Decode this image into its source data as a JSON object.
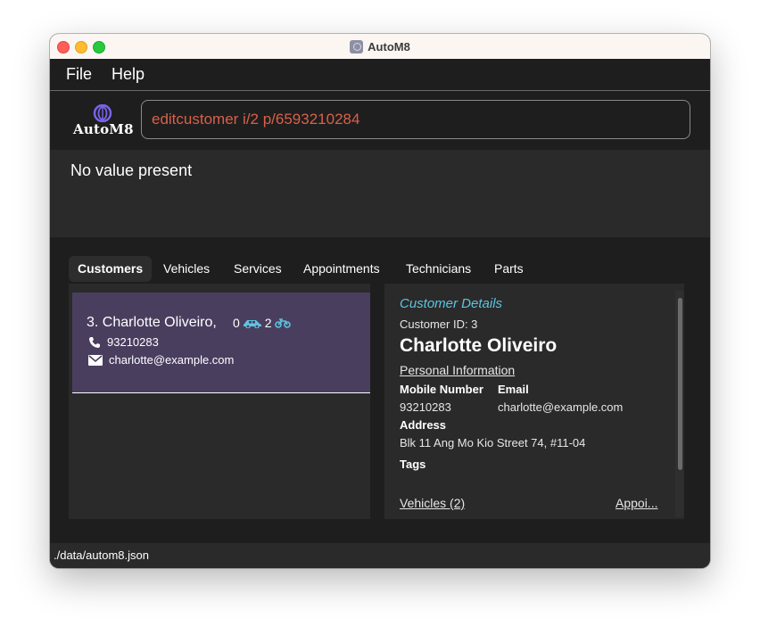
{
  "window": {
    "title": "AutoM8"
  },
  "menu": {
    "file": "File",
    "help": "Help"
  },
  "logo": {
    "text": "AutoM8"
  },
  "command": {
    "value": "editcustomer i/2 p/6593210284"
  },
  "result": {
    "text": "No value present"
  },
  "tabs": [
    {
      "label": "Customers",
      "active": true
    },
    {
      "label": "Vehicles",
      "active": false
    },
    {
      "label": "Services",
      "active": false
    },
    {
      "label": "Appointments",
      "active": false
    },
    {
      "label": "Technicians",
      "active": false
    },
    {
      "label": "Parts",
      "active": false
    }
  ],
  "customer_card": {
    "name": "3.  Charlotte Oliveiro,",
    "car_count": "0",
    "bike_count": "2",
    "phone": "93210283",
    "email": "charlotte@example.com"
  },
  "details": {
    "heading": "Customer Details",
    "id_text": "Customer ID: 3",
    "name": "Charlotte Oliveiro",
    "section": "Personal Information",
    "mobile_label": "Mobile Number",
    "mobile_value": "93210283",
    "email_label": "Email",
    "email_value": "charlotte@example.com",
    "address_label": "Address",
    "address_value": "Blk 11 Ang Mo Kio Street 74, #11-04",
    "tags_label": "Tags",
    "vehicles_link": "Vehicles (2)",
    "appointments_link": "Appoi..."
  },
  "status": {
    "path": "./data/autom8.json"
  },
  "colors": {
    "accent": "#5ec4df",
    "command_text": "#d9604a",
    "selected_card": "#4a3e5f"
  }
}
